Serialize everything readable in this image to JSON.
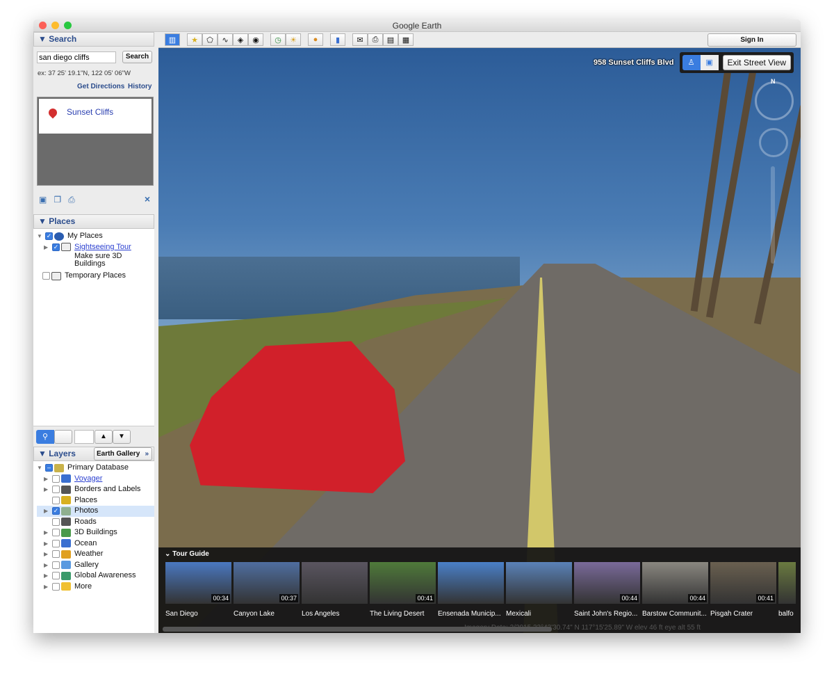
{
  "window": {
    "title": "Google Earth"
  },
  "search": {
    "header": "▼ Search",
    "query": "san diego cliffs",
    "button": "Search",
    "hint": "ex: 37 25' 19.1\"N, 122 05' 06\"W",
    "get_directions": "Get Directions",
    "history": "History",
    "result": "Sunset Cliffs"
  },
  "places": {
    "header": "▼ Places",
    "items": [
      {
        "label": "My Places",
        "checked": true
      },
      {
        "label": "Sightseeing Tour",
        "checked": true,
        "note": "Make sure 3D Buildings"
      },
      {
        "label": "Temporary Places",
        "checked": false
      }
    ]
  },
  "layers": {
    "header": "▼ Layers",
    "gallery_button": "Earth Gallery",
    "gallery_chevron": "»",
    "items": [
      {
        "label": "Primary Database",
        "checked": "partial",
        "color": "#c9b24a"
      },
      {
        "label": "Voyager",
        "checked": false,
        "link": true,
        "color": "#3a6fd0"
      },
      {
        "label": "Borders and Labels",
        "checked": false,
        "color": "#555"
      },
      {
        "label": "Places",
        "checked": false,
        "color": "#d8b020"
      },
      {
        "label": "Photos",
        "checked": true,
        "selected": true,
        "color": "#8fb08f"
      },
      {
        "label": "Roads",
        "checked": false,
        "color": "#555"
      },
      {
        "label": "3D Buildings",
        "checked": false,
        "color": "#4a9a4a"
      },
      {
        "label": "Ocean",
        "checked": false,
        "color": "#3a6fd0"
      },
      {
        "label": "Weather",
        "checked": false,
        "color": "#e0a020"
      },
      {
        "label": "Gallery",
        "checked": false,
        "color": "#5a9ae0"
      },
      {
        "label": "Global Awareness",
        "checked": false,
        "color": "#3a9a6a"
      },
      {
        "label": "More",
        "checked": false,
        "color": "#f0c030"
      }
    ]
  },
  "toolbar": {
    "sign_in": "Sign In"
  },
  "streetview": {
    "address": "958 Sunset Cliffs Blvd",
    "exit": "Exit Street View",
    "compass_n": "N"
  },
  "tour_guide": {
    "title": "Tour Guide",
    "items": [
      {
        "name": "San Diego",
        "duration": "00:34",
        "color": "#4a78c0"
      },
      {
        "name": "Canyon Lake",
        "duration": "00:37",
        "color": "#4f6ea0"
      },
      {
        "name": "Los Angeles",
        "duration": "",
        "color": "#5a5560"
      },
      {
        "name": "The Living Desert",
        "duration": "00:41",
        "color": "#4f7a3a"
      },
      {
        "name": "Ensenada Municip...",
        "duration": "",
        "color": "#4a80c8"
      },
      {
        "name": "Mexicali",
        "duration": "",
        "color": "#5a82b8"
      },
      {
        "name": "Saint John's Regio...",
        "duration": "00:44",
        "color": "#7a6a9a"
      },
      {
        "name": "Barstow Communit...",
        "duration": "00:44",
        "color": "#8a8780"
      },
      {
        "name": "Pisgah Crater",
        "duration": "00:41",
        "color": "#6a6050"
      },
      {
        "name": "balfo",
        "duration": "",
        "color": "#6a7a40"
      }
    ]
  },
  "status": {
    "text": "Imagery Date: 3/2015    32°43'30.74\" N  117°15'25.89\" W  elev  46 ft    eye alt  55 ft"
  }
}
